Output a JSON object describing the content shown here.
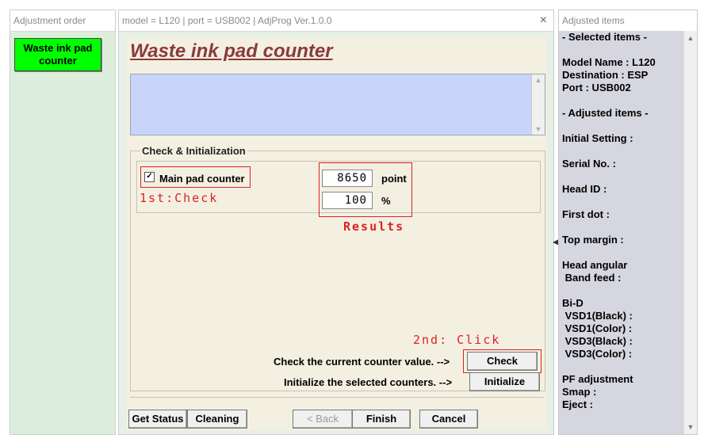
{
  "left_panel": {
    "title": "Adjustment order",
    "waste_button": "Waste ink pad\ncounter"
  },
  "main_window": {
    "title": "model = L120 | port = USB002 | AdjProg Ver.1.0.0",
    "close_icon": "×",
    "heading": "Waste ink pad counter",
    "group_title": "Check & Initialization",
    "main_pad_label": "Main pad counter",
    "main_pad_checked": true,
    "check_mark": "✓",
    "counter_value": "8650",
    "counter_unit": "point",
    "percent_value": "100",
    "percent_unit": "%",
    "annotation_first": "1st:Check",
    "annotation_results": "Results",
    "annotation_second": "2nd: Click",
    "check_label": "Check the current counter value. -->",
    "check_button": "Check",
    "init_label": "Initialize the selected counters. -->",
    "init_button": "Initialize",
    "footer_buttons": {
      "get_status": "Get Status",
      "cleaning": "Cleaning",
      "back": "< Back",
      "finish": "Finish",
      "cancel": "Cancel"
    }
  },
  "right_panel": {
    "title": "Adjusted items",
    "items": "- Selected items -\n\nModel Name : L120\nDestination : ESP\nPort : USB002\n\n- Adjusted items -\n\nInitial Setting :\n\nSerial No. :\n\nHead ID :\n\nFirst dot :\n\nTop margin :\n\nHead angular\n Band feed :\n\nBi-D\n VSD1(Black) :\n VSD1(Color) :\n VSD3(Black) :\n VSD3(Color) :\n\nPF adjustment\nSmap :\nEject :"
  },
  "colors": {
    "annotation_red": "#e02020",
    "heading": "#8b3a3a",
    "waste_button_bg": "#00ff00",
    "textarea_bg": "#c8d4fa"
  },
  "icons": [
    "close-icon",
    "checkbox-check-icon",
    "scroll-up-icon",
    "scroll-down-icon",
    "chevron-left-icon"
  ]
}
